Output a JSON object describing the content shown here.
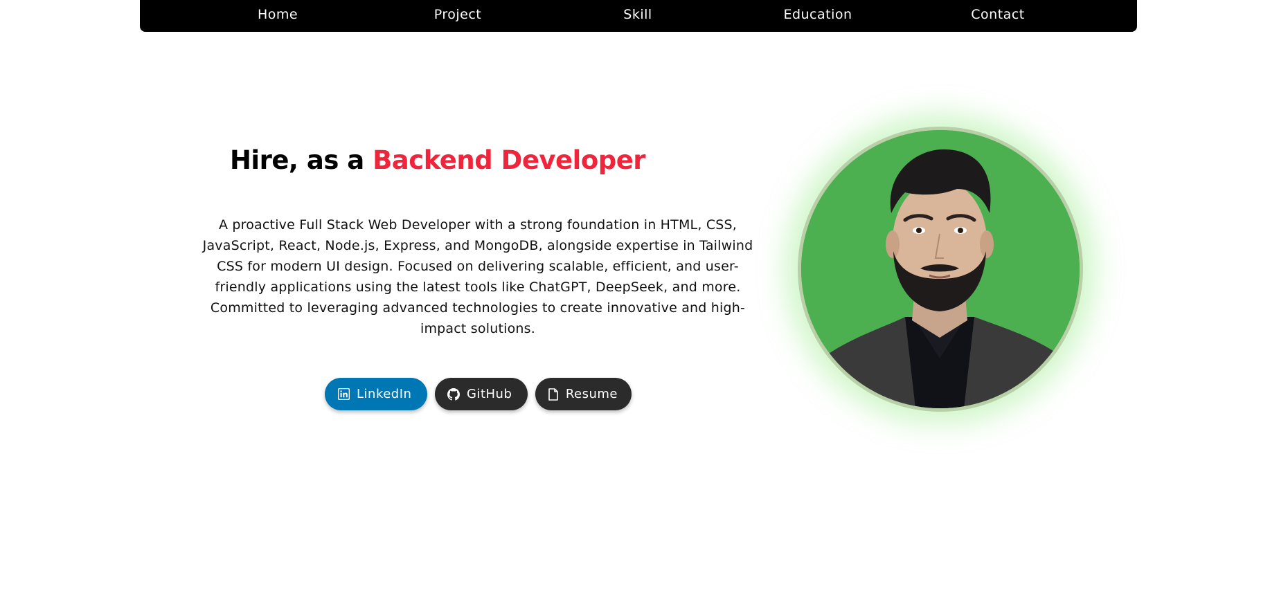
{
  "nav": {
    "items": [
      {
        "label": "Home"
      },
      {
        "label": "Project"
      },
      {
        "label": "Skill"
      },
      {
        "label": "Education"
      },
      {
        "label": "Contact"
      }
    ]
  },
  "hero": {
    "title_prefix": "Hire, as a ",
    "title_accent": "Backend Developer",
    "description": "A proactive Full Stack Web Developer with a strong foundation in HTML, CSS, JavaScript, React, Node.js, Express, and MongoDB, alongside expertise in Tailwind CSS for modern UI design. Focused on delivering scalable, efficient, and user-friendly applications using the latest tools like ChatGPT, DeepSeek, and more. Committed to leveraging advanced technologies to create innovative and high-impact solutions.",
    "buttons": {
      "linkedin": {
        "label": "LinkedIn",
        "icon": "linkedin-icon"
      },
      "github": {
        "label": "GitHub",
        "icon": "github-icon"
      },
      "resume": {
        "label": "Resume",
        "icon": "file-icon"
      }
    }
  },
  "colors": {
    "accent": "#f0243a",
    "nav_bg": "#000000",
    "linkedin": "#0077b5",
    "button_dark": "#2b2b2b",
    "portrait_bg": "#4caf50"
  }
}
